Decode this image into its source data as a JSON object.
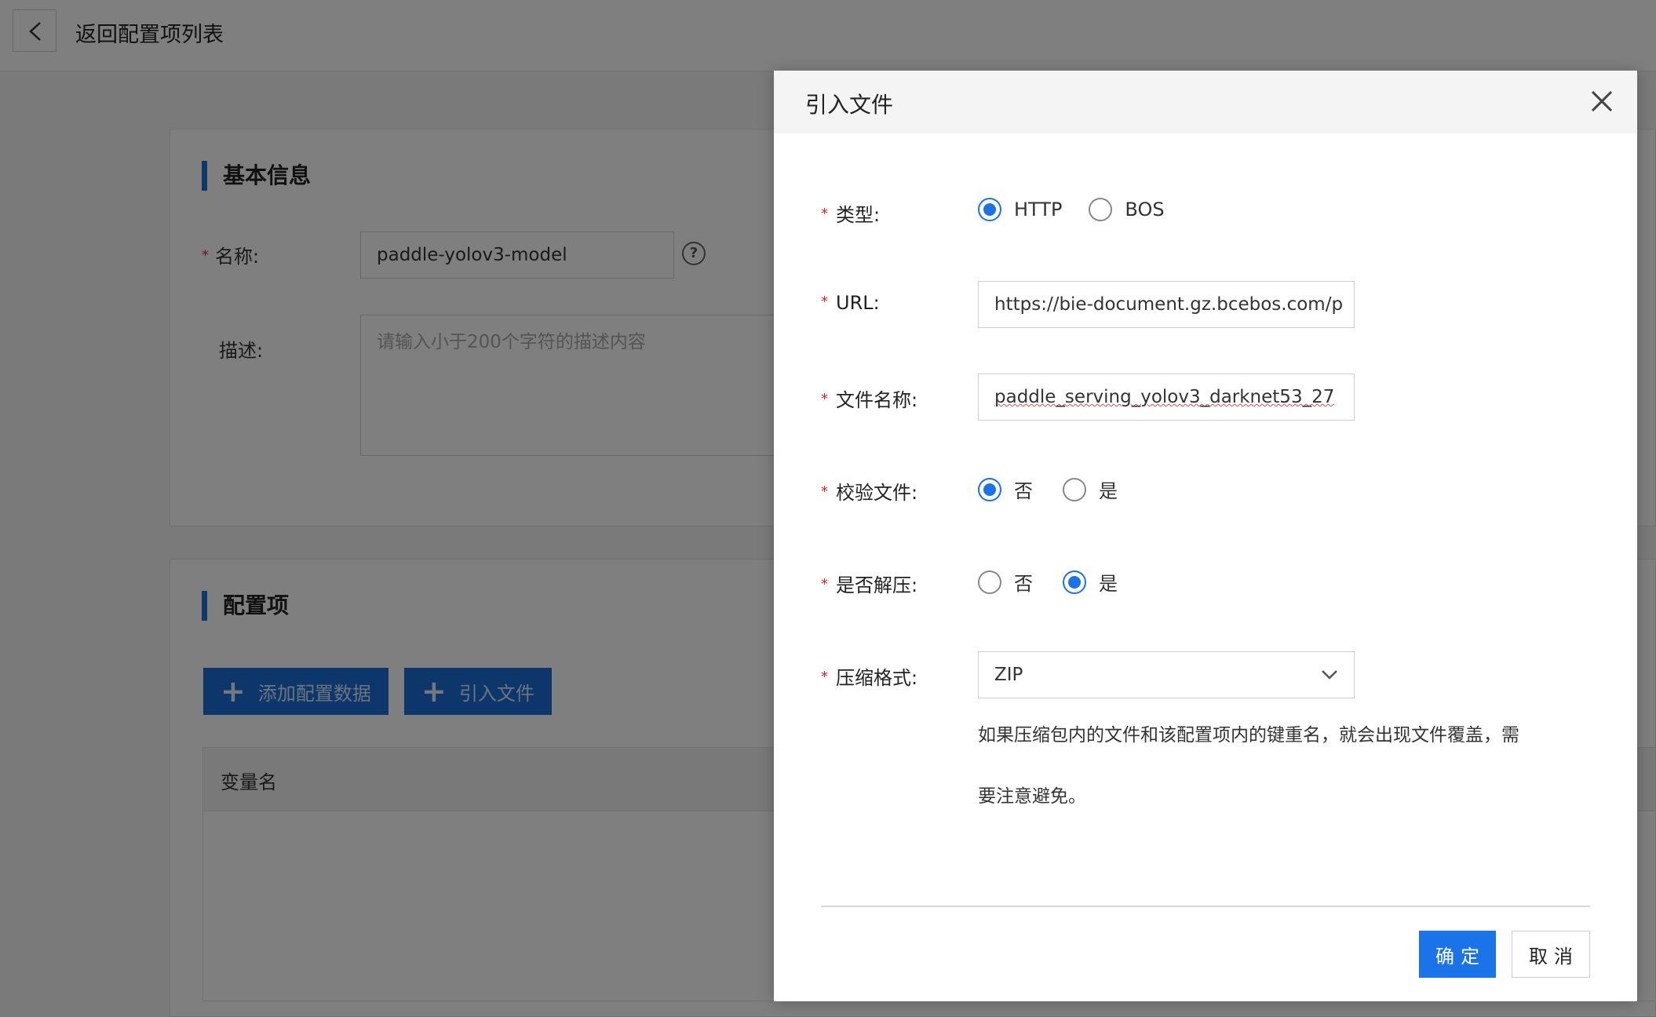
{
  "header": {
    "back_label": "返回配置项列表"
  },
  "basic_info": {
    "title": "基本信息",
    "name_label": "名称:",
    "name_value": "paddle-yolov3-model",
    "help_glyph": "?",
    "desc_label": "描述:",
    "desc_placeholder": "请输入小于200个字符的描述内容"
  },
  "config_section": {
    "title": "配置项",
    "add_button": "添加配置数据",
    "import_button": "引入文件",
    "table_header": "变量名"
  },
  "modal": {
    "title": "引入文件",
    "type_label": "类型:",
    "type_options": [
      "HTTP",
      "BOS"
    ],
    "type_selected": "HTTP",
    "url_label": "URL:",
    "url_value": "https://bie-document.gz.bcebos.com/p",
    "filename_label": "文件名称:",
    "filename_value": "paddle_serving_yolov3_darknet53_27",
    "verify_label": "校验文件:",
    "verify_options": [
      "否",
      "是"
    ],
    "verify_selected": "否",
    "unzip_label": "是否解压:",
    "unzip_options": [
      "否",
      "是"
    ],
    "unzip_selected": "是",
    "format_label": "压缩格式:",
    "format_value": "ZIP",
    "hint_line1": "如果压缩包内的文件和该配置项内的键重名，就会出现文件覆盖，需",
    "hint_line2": "要注意避免。",
    "ok_button": "确定",
    "cancel_button": "取消"
  },
  "colors": {
    "primary": "#1a73e8",
    "required": "#e02424",
    "overlay": "rgba(0,0,0,0.5)"
  },
  "icons": [
    "chevron-left-icon",
    "help-icon",
    "plus-icon",
    "close-icon",
    "chevron-down-icon"
  ]
}
